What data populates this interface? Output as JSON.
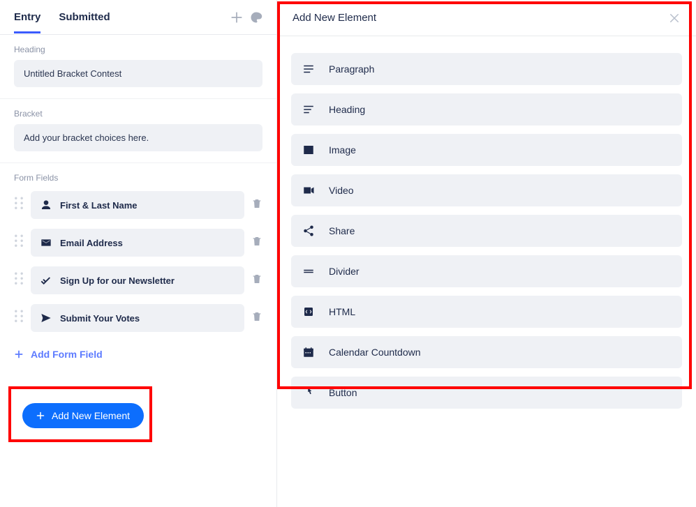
{
  "tabs": {
    "entry": "Entry",
    "submitted": "Submitted"
  },
  "heading": {
    "label": "Heading",
    "value": "Untitled Bracket Contest"
  },
  "bracket": {
    "label": "Bracket",
    "value": "Add your bracket choices here."
  },
  "form_fields": {
    "label": "Form Fields",
    "items": [
      {
        "icon": "user-icon",
        "label": "First & Last Name"
      },
      {
        "icon": "email-icon",
        "label": "Email Address"
      },
      {
        "icon": "check-icon",
        "label": "Sign Up for our Newsletter"
      },
      {
        "icon": "send-icon",
        "label": "Submit Your Votes"
      }
    ],
    "add_link": "Add Form Field"
  },
  "add_element_button": "Add New Element",
  "modal": {
    "title": "Add New Element",
    "elements": [
      {
        "icon": "paragraph-icon",
        "label": "Paragraph"
      },
      {
        "icon": "heading-icon",
        "label": "Heading"
      },
      {
        "icon": "image-icon",
        "label": "Image"
      },
      {
        "icon": "video-icon",
        "label": "Video"
      },
      {
        "icon": "share-icon",
        "label": "Share"
      },
      {
        "icon": "divider-icon",
        "label": "Divider"
      },
      {
        "icon": "html-icon",
        "label": "HTML"
      },
      {
        "icon": "calendar-icon",
        "label": "Calendar Countdown"
      },
      {
        "icon": "button-icon",
        "label": "Button"
      }
    ]
  },
  "colors": {
    "accent": "#3b5bfd",
    "primary_btn": "#0d6efd",
    "highlight": "#ff0000",
    "text": "#1e2a4a",
    "muted": "#8a92a6",
    "card_bg": "#eff1f5"
  }
}
